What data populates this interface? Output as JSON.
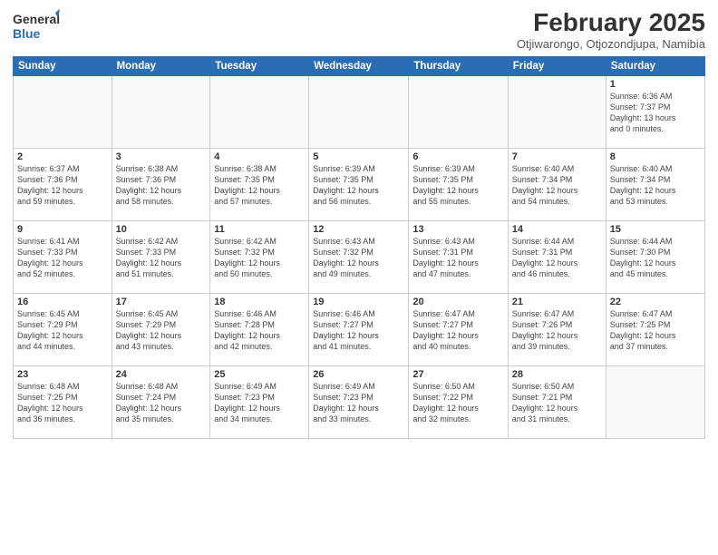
{
  "logo": {
    "general": "General",
    "blue": "Blue"
  },
  "title": "February 2025",
  "location": "Otjiwarongo, Otjozondjupa, Namibia",
  "days_of_week": [
    "Sunday",
    "Monday",
    "Tuesday",
    "Wednesday",
    "Thursday",
    "Friday",
    "Saturday"
  ],
  "weeks": [
    [
      {
        "day": "",
        "info": ""
      },
      {
        "day": "",
        "info": ""
      },
      {
        "day": "",
        "info": ""
      },
      {
        "day": "",
        "info": ""
      },
      {
        "day": "",
        "info": ""
      },
      {
        "day": "",
        "info": ""
      },
      {
        "day": "1",
        "info": "Sunrise: 6:36 AM\nSunset: 7:37 PM\nDaylight: 13 hours\nand 0 minutes."
      }
    ],
    [
      {
        "day": "2",
        "info": "Sunrise: 6:37 AM\nSunset: 7:36 PM\nDaylight: 12 hours\nand 59 minutes."
      },
      {
        "day": "3",
        "info": "Sunrise: 6:38 AM\nSunset: 7:36 PM\nDaylight: 12 hours\nand 58 minutes."
      },
      {
        "day": "4",
        "info": "Sunrise: 6:38 AM\nSunset: 7:35 PM\nDaylight: 12 hours\nand 57 minutes."
      },
      {
        "day": "5",
        "info": "Sunrise: 6:39 AM\nSunset: 7:35 PM\nDaylight: 12 hours\nand 56 minutes."
      },
      {
        "day": "6",
        "info": "Sunrise: 6:39 AM\nSunset: 7:35 PM\nDaylight: 12 hours\nand 55 minutes."
      },
      {
        "day": "7",
        "info": "Sunrise: 6:40 AM\nSunset: 7:34 PM\nDaylight: 12 hours\nand 54 minutes."
      },
      {
        "day": "8",
        "info": "Sunrise: 6:40 AM\nSunset: 7:34 PM\nDaylight: 12 hours\nand 53 minutes."
      }
    ],
    [
      {
        "day": "9",
        "info": "Sunrise: 6:41 AM\nSunset: 7:33 PM\nDaylight: 12 hours\nand 52 minutes."
      },
      {
        "day": "10",
        "info": "Sunrise: 6:42 AM\nSunset: 7:33 PM\nDaylight: 12 hours\nand 51 minutes."
      },
      {
        "day": "11",
        "info": "Sunrise: 6:42 AM\nSunset: 7:32 PM\nDaylight: 12 hours\nand 50 minutes."
      },
      {
        "day": "12",
        "info": "Sunrise: 6:43 AM\nSunset: 7:32 PM\nDaylight: 12 hours\nand 49 minutes."
      },
      {
        "day": "13",
        "info": "Sunrise: 6:43 AM\nSunset: 7:31 PM\nDaylight: 12 hours\nand 47 minutes."
      },
      {
        "day": "14",
        "info": "Sunrise: 6:44 AM\nSunset: 7:31 PM\nDaylight: 12 hours\nand 46 minutes."
      },
      {
        "day": "15",
        "info": "Sunrise: 6:44 AM\nSunset: 7:30 PM\nDaylight: 12 hours\nand 45 minutes."
      }
    ],
    [
      {
        "day": "16",
        "info": "Sunrise: 6:45 AM\nSunset: 7:29 PM\nDaylight: 12 hours\nand 44 minutes."
      },
      {
        "day": "17",
        "info": "Sunrise: 6:45 AM\nSunset: 7:29 PM\nDaylight: 12 hours\nand 43 minutes."
      },
      {
        "day": "18",
        "info": "Sunrise: 6:46 AM\nSunset: 7:28 PM\nDaylight: 12 hours\nand 42 minutes."
      },
      {
        "day": "19",
        "info": "Sunrise: 6:46 AM\nSunset: 7:27 PM\nDaylight: 12 hours\nand 41 minutes."
      },
      {
        "day": "20",
        "info": "Sunrise: 6:47 AM\nSunset: 7:27 PM\nDaylight: 12 hours\nand 40 minutes."
      },
      {
        "day": "21",
        "info": "Sunrise: 6:47 AM\nSunset: 7:26 PM\nDaylight: 12 hours\nand 39 minutes."
      },
      {
        "day": "22",
        "info": "Sunrise: 6:47 AM\nSunset: 7:25 PM\nDaylight: 12 hours\nand 37 minutes."
      }
    ],
    [
      {
        "day": "23",
        "info": "Sunrise: 6:48 AM\nSunset: 7:25 PM\nDaylight: 12 hours\nand 36 minutes."
      },
      {
        "day": "24",
        "info": "Sunrise: 6:48 AM\nSunset: 7:24 PM\nDaylight: 12 hours\nand 35 minutes."
      },
      {
        "day": "25",
        "info": "Sunrise: 6:49 AM\nSunset: 7:23 PM\nDaylight: 12 hours\nand 34 minutes."
      },
      {
        "day": "26",
        "info": "Sunrise: 6:49 AM\nSunset: 7:23 PM\nDaylight: 12 hours\nand 33 minutes."
      },
      {
        "day": "27",
        "info": "Sunrise: 6:50 AM\nSunset: 7:22 PM\nDaylight: 12 hours\nand 32 minutes."
      },
      {
        "day": "28",
        "info": "Sunrise: 6:50 AM\nSunset: 7:21 PM\nDaylight: 12 hours\nand 31 minutes."
      },
      {
        "day": "",
        "info": ""
      }
    ]
  ]
}
